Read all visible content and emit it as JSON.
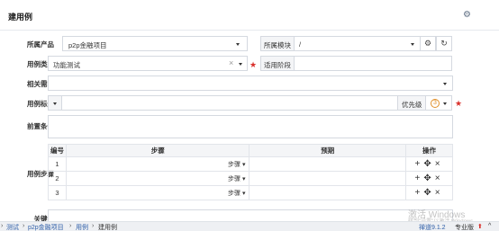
{
  "header": {
    "title": "建用例",
    "settings_icon": "gear-icon"
  },
  "form": {
    "product": {
      "label": "所属产品",
      "value": "p2p金融项目"
    },
    "module": {
      "addon": "所属模块",
      "value": "/"
    },
    "case_type": {
      "label": "用例类型",
      "value": "功能测试",
      "clear": "×"
    },
    "stage": {
      "addon": "适用阶段",
      "value": ""
    },
    "story": {
      "label": "相关需求",
      "value": ""
    },
    "case_title": {
      "label": "用例标题",
      "value": "",
      "priority_label": "优先级",
      "priority_value": "3"
    },
    "precondition": {
      "label": "前置条件",
      "value": ""
    },
    "steps": {
      "label": "用例步骤",
      "headers": [
        "编号",
        "步骤",
        "预期",
        "操作"
      ],
      "rows": [
        {
          "num": "1",
          "type": "步骤"
        },
        {
          "num": "2",
          "type": "步骤"
        },
        {
          "num": "3",
          "type": "步骤"
        }
      ],
      "ops": [
        "+",
        "✥",
        "×"
      ]
    },
    "keywords": {
      "label": "关键词"
    }
  },
  "breadcrumb": [
    "测试",
    "p2p金融项目",
    "用例",
    "建用例"
  ],
  "breadcrumb_sep": "›",
  "watermark": {
    "line1": "激活 Windows",
    "line2": "转到\"设置\"以激活 Windows。"
  },
  "version": "禅道9.1.2",
  "edition": "专业版"
}
